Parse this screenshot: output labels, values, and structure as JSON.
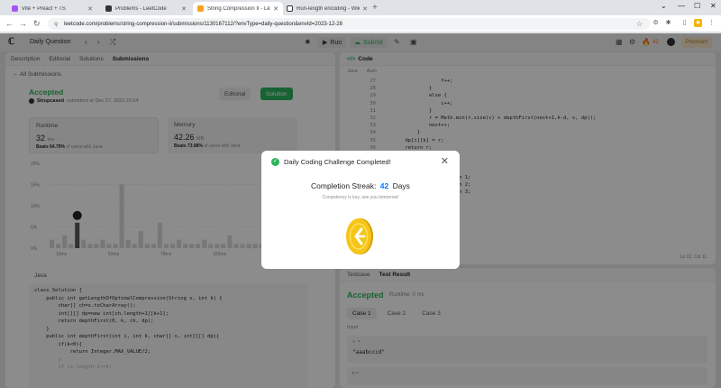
{
  "browser": {
    "tabs": [
      {
        "title": "Vite + Preact + TS",
        "color": "#a855f7"
      },
      {
        "title": "Problems - LeetCode",
        "color": "#333333"
      },
      {
        "title": "String Compression II - LeetCo...",
        "color": "#f89f1b"
      },
      {
        "title": "Run-length encoding - Wikipe...",
        "color": "#333333"
      }
    ],
    "url": "leetcode.com/problems/string-compression-ii/submissions/1130167112/?envType=daily-question&envId=2023-12-28",
    "controls": {
      "minimize": "⌄",
      "min2": "—",
      "max": "☐",
      "close": "✕"
    }
  },
  "lc_nav": {
    "daily_question": "Daily Question",
    "run": "Run",
    "submit": "Submit",
    "streak": "42",
    "premium": "Premium"
  },
  "left": {
    "tabs": [
      "Description",
      "Editorial",
      "Solutions",
      "Submissions"
    ],
    "all_submissions": "All Submissions",
    "status": "Accepted",
    "user": "Strupcased",
    "submitted_at": "submitted at Dec 27, 2023 23:54",
    "editorial_btn": "Editorial",
    "solution_btn": "Solution",
    "runtime": {
      "label": "Runtime",
      "value": "32",
      "unit": "ms",
      "beats": "Beats 64.79%",
      "of": "of users with Java"
    },
    "memory": {
      "label": "Memory",
      "value": "42.26",
      "unit": "MB",
      "beats": "Beats 73.88%",
      "of": "of users with Java"
    },
    "code_lang": "Java",
    "code_lines": [
      "class Solution {",
      "    public int getLengthOfOptimalCompression(String s, int k) {",
      "        char[] ch=s.toCharArray();",
      "        int[][] dp=new int[ch.length+1][k+1];",
      "        return depthFirst(0, k, ch, dp);",
      "    }",
      "    public int depthFirst(int i, int k, char[] s, int[][] dp){",
      "        if(k<0){",
      "            return Integer.MAX_VALUE/2;",
      "        }",
      "        if (s.length-i<=k)"
    ]
  },
  "chart_data": {
    "type": "bar",
    "ylabel_ticks": [
      "20%",
      "15%",
      "10%",
      "5%",
      "0%"
    ],
    "xlabels": [
      "10ms",
      "52ms",
      "78ms",
      "103ms",
      "129ms"
    ],
    "ylim": [
      0,
      20
    ],
    "values": [
      2,
      1,
      3,
      1,
      6,
      2,
      1,
      1,
      2,
      1,
      1,
      15,
      2,
      1,
      4,
      1,
      1,
      6,
      1,
      1,
      2,
      1,
      1,
      1,
      2,
      1,
      1,
      1,
      3,
      1,
      1,
      1,
      1,
      1,
      1,
      1,
      1,
      1,
      1,
      1
    ]
  },
  "right": {
    "title": "Code",
    "lang": "Java",
    "mode": "Auto",
    "line_numbers": [
      "27",
      "28",
      "29",
      "30",
      "31",
      "32",
      "33",
      "34",
      "35",
      "36",
      "37",
      "38",
      "39",
      "40",
      "41",
      "42",
      "43",
      "44",
      "45",
      "46",
      "47",
      "48",
      "49",
      "50",
      "51",
      "52"
    ],
    "code_lines": [
      "                    f++;",
      "                }",
      "                else {",
      "                    c++;",
      "                }",
      "                r = Math.min(r,size(c) + depthFirst(next+1,k-d, s, dp));",
      "                next++;",
      "            }",
      "        dp[i][k] = r;",
      "        return r;",
      "    }",
      "",
      "",
      "                        urn 1;",
      "                        urn 2;",
      "                        urn 3;",
      "",
      "",
      "",
      "",
      "",
      "",
      "",
      "",
      "",
      ""
    ],
    "footer": "Ln 22, Col 11"
  },
  "bottom": {
    "tabs": [
      "Testcase",
      "Test Result"
    ],
    "status": "Accepted",
    "runtime": "Runtime: 0 ms",
    "cases": [
      "Case 1",
      "Case 2",
      "Case 3"
    ],
    "input_label": "Input",
    "input_key": "s =",
    "input_value": "\"aaabcccd\"",
    "k_key": "k ="
  },
  "modal": {
    "title": "Daily Coding Challenge Completed!",
    "streak_label": "Completion Streak:",
    "streak_value": "42",
    "streak_unit": "Days",
    "subtitle": "Consistency is key, see you tomorrow!"
  },
  "colors": {
    "accent": "#2db55d",
    "streak": "#007aff",
    "coin": "#f5c518"
  }
}
